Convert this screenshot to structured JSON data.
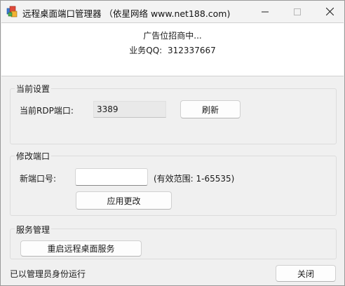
{
  "window": {
    "title": "远程桌面端口管理器 （依星网络 www.net188.com)"
  },
  "ad": {
    "line1": "广告位招商中...",
    "line2_label": "业务QQ:",
    "line2_value": "312337667"
  },
  "current_settings": {
    "group_label": "当前设置",
    "port_label": "当前RDP端口:",
    "port_value": "3389",
    "refresh_button": "刷新"
  },
  "modify_port": {
    "group_label": "修改端口",
    "new_port_label": "新端口号:",
    "new_port_value": "",
    "range_hint": "(有效范围: 1-65535)",
    "apply_button": "应用更改"
  },
  "service": {
    "group_label": "服务管理",
    "restart_button": "重启远程桌面服务"
  },
  "footer": {
    "status_text": "已以管理员身份运行",
    "close_button": "关闭"
  }
}
